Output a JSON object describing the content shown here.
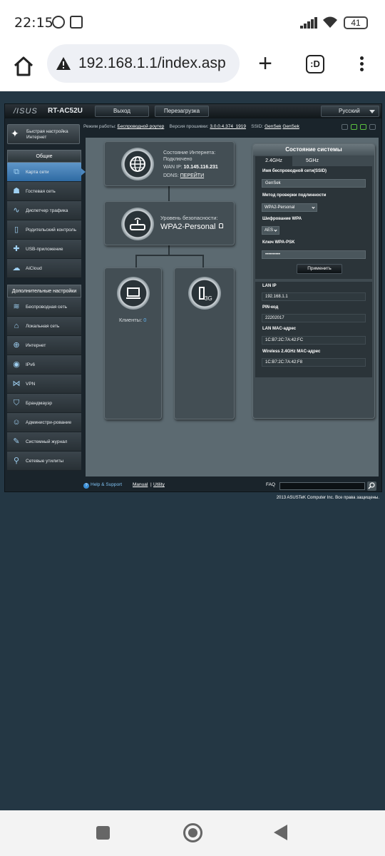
{
  "status": {
    "time": "22:15",
    "battery": "41"
  },
  "browser": {
    "url": "192.168.1.1/index.asp",
    "tabs_label": ":D"
  },
  "router": {
    "logo": "/ISUS",
    "model": "RT-AC52U",
    "logout": "Выход",
    "reboot": "Перезагрузка",
    "language": "Русский",
    "info": {
      "mode_label": "Режим работы:",
      "mode_value": "Беспроводной роутер",
      "firmware_label": "Версия прошивки:",
      "firmware_value": "3.0.0.4.374_1919",
      "ssid_label": "SSID:",
      "ssid_value_1": "GenSek",
      "ssid_value_2": "GenSek"
    },
    "quick_setup": "Быстрая настройка Интернет",
    "nav_general": {
      "header": "Общие",
      "items": [
        {
          "label": "Карта сети",
          "icon": "network-map-icon"
        },
        {
          "label": "Гостевая сеть",
          "icon": "guest-network-icon"
        },
        {
          "label": "Диспетчер трафика",
          "icon": "traffic-manager-icon"
        },
        {
          "label": "Родительский контроль",
          "icon": "parental-control-icon"
        },
        {
          "label": "USB-приложение",
          "icon": "usb-app-icon"
        },
        {
          "label": "AiCloud",
          "icon": "aicloud-icon"
        }
      ]
    },
    "nav_advanced": {
      "header": "Дополнительные настройки",
      "items": [
        {
          "label": "Беспроводная сеть",
          "icon": "wireless-icon"
        },
        {
          "label": "Локальная сеть",
          "icon": "lan-icon"
        },
        {
          "label": "Интернет",
          "icon": "wan-icon"
        },
        {
          "label": "IPv6",
          "icon": "ipv6-icon"
        },
        {
          "label": "VPN",
          "icon": "vpn-icon"
        },
        {
          "label": "Брандмауэр",
          "icon": "firewall-icon"
        },
        {
          "label": "Администри-рование",
          "icon": "administration-icon"
        },
        {
          "label": "Системный журнал",
          "icon": "system-log-icon"
        },
        {
          "label": "Сетевые утилиты",
          "icon": "network-tools-icon"
        }
      ]
    },
    "internet": {
      "status_label": "Состояние Интернета:",
      "status_value": "Подключено",
      "wan_label": "WAN IP:",
      "wan_value": "10.145.116.231",
      "ddns_label": "DDNS:",
      "ddns_value": "ПЕРЕЙТИ"
    },
    "security": {
      "label": "Уровень безопасности:",
      "value": "WPA2-Personal"
    },
    "clients": {
      "label": "Клиенты:",
      "count": "0"
    },
    "usb_label": "3G",
    "system": {
      "title": "Состояние системы",
      "tab_24": "2.4GHz",
      "tab_5": "5GHz",
      "ssid_label": "Имя беспроводной сети(SSID)",
      "ssid_value": "GenSek",
      "auth_label": "Метод проверки подлинности",
      "auth_value": "WPA2-Personal",
      "enc_label": "Шифрование WPA",
      "enc_value": "AES",
      "psk_label": "Ключ WPA-PSK",
      "psk_value": "••••••••••",
      "apply": "Применить",
      "lan_ip_label": "LAN IP",
      "lan_ip_value": "192.168.1.1",
      "pin_label": "PIN-код",
      "pin_value": "22202017",
      "lan_mac_label": "LAN MAC-адрес",
      "lan_mac_value": "1C:B7:2C:7A:42:FC",
      "wl_mac_label": "Wireless 2.4GHz MAC-адрес",
      "wl_mac_value": "1C:B7:2C:7A:42:F8"
    },
    "footer": {
      "help": "Help & Support",
      "manual": "Manual",
      "separator": "|",
      "utility": "Utility",
      "faq": "FAQ",
      "copyright": "2013 ASUSTeK Computer Inc. Все права защищены."
    }
  }
}
